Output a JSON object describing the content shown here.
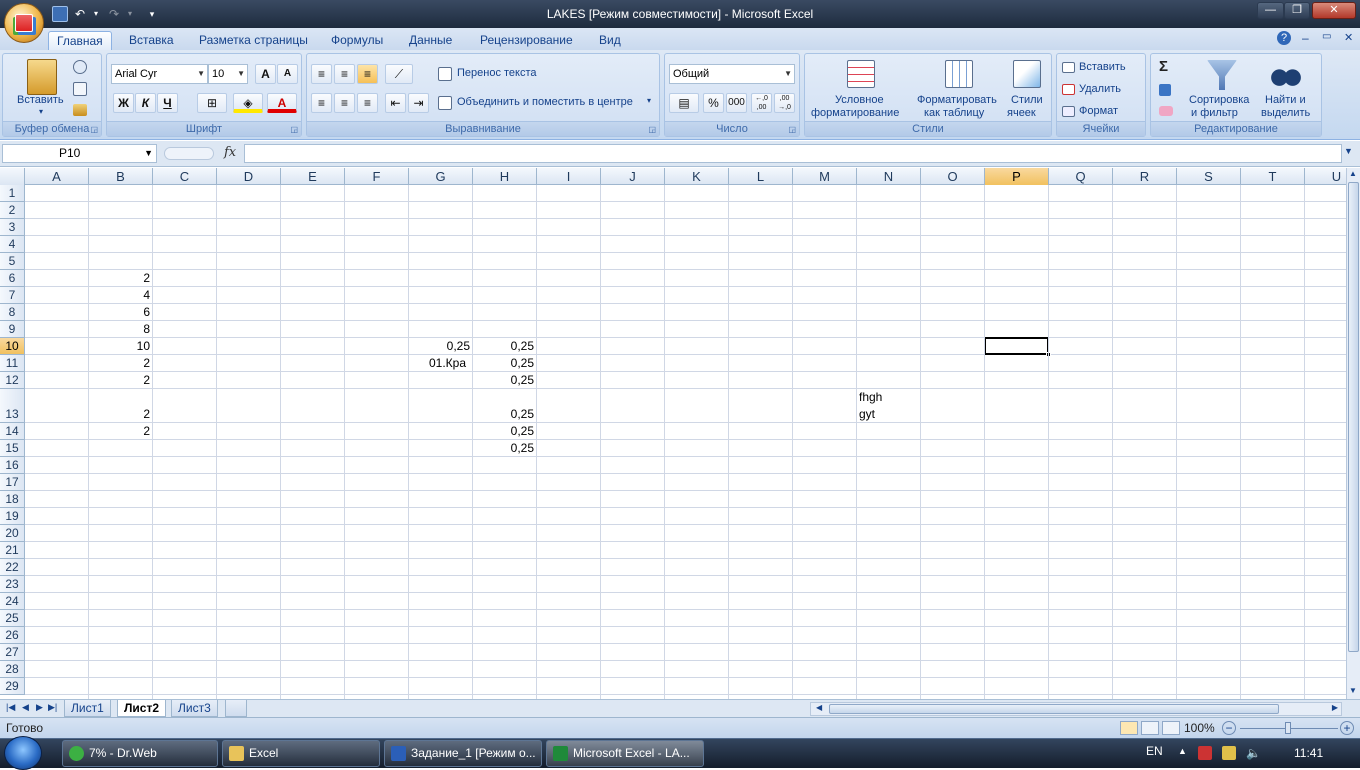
{
  "window": {
    "title": "LAKES  [Режим совместимости] - Microsoft Excel",
    "ribbon_min_glyph": "▭",
    "help_glyph": "?"
  },
  "icons": {
    "save": "save-icon",
    "undo": "undo-icon",
    "redo": "redo-icon",
    "customize": "customize-qat-icon",
    "minimize": "minimize-icon",
    "restore": "restore-icon",
    "close": "close-icon"
  },
  "qat_glyphs": {
    "undo": "↶",
    "redo": "↷",
    "customize": "▾"
  },
  "window_glyphs": {
    "minimize": "—",
    "restore": "❐",
    "close": "✕",
    "inner_min": "–",
    "inner_restore": "▭",
    "inner_close": "✕"
  },
  "tabs": [
    "Главная",
    "Вставка",
    "Разметка страницы",
    "Формулы",
    "Данные",
    "Рецензирование",
    "Вид"
  ],
  "ribbon": {
    "clipboard": {
      "label": "Буфер обмена",
      "paste": "Вставить"
    },
    "font": {
      "label": "Шрифт",
      "font_name": "Arial Cyr",
      "font_size": "10",
      "grow": "A",
      "shrink": "A",
      "bold": "Ж",
      "italic": "К",
      "underline": "Ч"
    },
    "alignment": {
      "label": "Выравнивание",
      "wrap_text": "Перенос текста",
      "merge_center": "Объединить и поместить в центре"
    },
    "number": {
      "label": "Число",
      "format": "Общий",
      "percent": "%",
      "thousands": "000",
      "inc_dec": "←,0 ,00",
      "dec_dec": ",00 →,0"
    },
    "styles": {
      "label": "Стили",
      "conditional": "Условное форматирование",
      "conditional_l1": "Условное",
      "conditional_l2": "форматирование",
      "format_table_l1": "Форматировать",
      "format_table_l2": "как таблицу",
      "cell_styles_l1": "Стили",
      "cell_styles_l2": "ячеек"
    },
    "cells": {
      "label": "Ячейки",
      "insert": "Вставить",
      "delete": "Удалить",
      "format": "Формат"
    },
    "editing": {
      "label": "Редактирование",
      "sum": "Σ",
      "sort_l1": "Сортировка",
      "sort_l2": "и фильтр",
      "find_l1": "Найти и",
      "find_l2": "выделить"
    }
  },
  "formula_bar": {
    "name_box": "P10",
    "fx": "fx",
    "formula": ""
  },
  "columns": [
    "A",
    "B",
    "C",
    "D",
    "E",
    "F",
    "G",
    "H",
    "I",
    "J",
    "K",
    "L",
    "M",
    "N",
    "O",
    "P",
    "Q",
    "R",
    "S",
    "T",
    "U"
  ],
  "selected_column": "P",
  "rows": [
    "1",
    "2",
    "3",
    "4",
    "5",
    "6",
    "7",
    "8",
    "9",
    "10",
    "11",
    "12",
    "13",
    "14",
    "15",
    "16",
    "17",
    "18",
    "19",
    "20",
    "21",
    "22",
    "23",
    "24",
    "25",
    "26",
    "27",
    "28",
    "29"
  ],
  "selected_row": "10",
  "cells": {
    "B6": "2",
    "B7": "4",
    "B8": "6",
    "B9": "8",
    "B10": "10",
    "B11": "2",
    "B12": "2",
    "B13": "2",
    "B14": "2",
    "G10": "0,25",
    "G11": "01.Кра",
    "H10": "0,25",
    "H11": "0,25",
    "H12": "0,25",
    "H13": "0,25",
    "H14": "0,25",
    "H15": "0,25",
    "N13_line1": "fhgh",
    "N13_line2": "gyt"
  },
  "sheets": [
    "Лист1",
    "Лист2",
    "Лист3"
  ],
  "active_sheet": "Лист2",
  "status": {
    "ready": "Готово",
    "zoom": "100%"
  },
  "taskbar": {
    "tasks": [
      "7% - Dr.Web",
      "Excel",
      "Задание_1 [Режим о...",
      "Microsoft Excel - LA..."
    ],
    "lang": "EN",
    "time": "11:41"
  }
}
